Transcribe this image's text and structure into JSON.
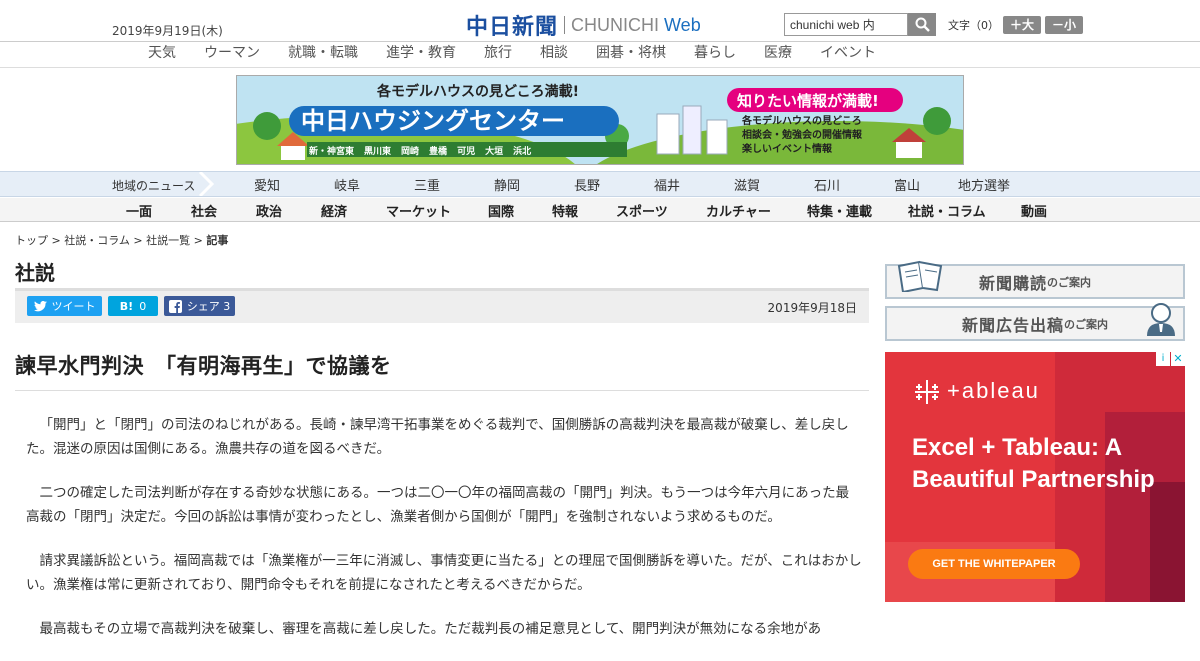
{
  "header": {
    "date": "2019年9月19日(木)",
    "logo_kanji": "中日新聞",
    "logo_en": "CHUNICHI",
    "logo_web": "Web",
    "search_value": "chunichi web 内",
    "font_label": "文字（0）",
    "font_bigger": "＋大",
    "font_smaller": "－小"
  },
  "topnav": [
    "天気",
    "ウーマン",
    "就職・転職",
    "進学・教育",
    "旅行",
    "相談",
    "囲碁・将棋",
    "暮らし",
    "医療",
    "イベント"
  ],
  "banner": {
    "line1": "各モデルハウスの見どころ満載!",
    "line2": "中日ハウジングセンター",
    "right_title": "知りたい情報が満載!",
    "right_items": [
      "各モデルハウスの見どころ",
      "相談会・勉強会の開催情報",
      "楽しいイベント情報"
    ],
    "places": [
      "新・神宮東",
      "黒川東",
      "岡崎",
      "豊橋",
      "可児",
      "大垣",
      "浜北"
    ]
  },
  "region_nav": {
    "label": "地域のニュース",
    "items": [
      "愛知",
      "岐阜",
      "三重",
      "静岡",
      "長野",
      "福井",
      "滋賀",
      "石川",
      "富山",
      "地方選挙"
    ]
  },
  "category_nav": [
    "一面",
    "社会",
    "政治",
    "経済",
    "マーケット",
    "国際",
    "特報",
    "スポーツ",
    "カルチャー",
    "特集・連載",
    "社説・コラム",
    "動画"
  ],
  "breadcrumb": {
    "items": [
      "トップ",
      "社説・コラム",
      "社説一覧"
    ],
    "current": "記事",
    "sep": " > "
  },
  "section_title": "社説",
  "share": {
    "tweet": "ツイート",
    "hatena": "B!",
    "hatena_count": "0",
    "facebook": "シェア",
    "facebook_count": "3"
  },
  "publish_date": "2019年9月18日",
  "headline": "諫早水門判決　「有明海再生」で協議を",
  "paragraphs": [
    "「開門」と「閉門」の司法のねじれがある。長崎・諫早湾干拓事業をめぐる裁判で、国側勝訴の高裁判決を最高裁が破棄し、差し戻した。混迷の原因は国側にある。漁農共存の道を図るべきだ。",
    "二つの確定した司法判断が存在する奇妙な状態にある。一つは二〇一〇年の福岡高裁の「開門」判決。もう一つは今年六月にあった最高裁の「閉門」決定だ。今回の訴訟は事情が変わったとし、漁業者側から国側が「開門」を強制されないよう求めるものだ。",
    "請求異議訴訟という。福岡高裁では「漁業権が一三年に消滅し、事情変更に当たる」との理屈で国側勝訴を導いた。だが、これはおかしい。漁業権は常に更新されており、開門命令もそれを前提になされたと考えるべきだからだ。",
    "最高裁もその立場で高裁判決を破棄し、審理を高裁に差し戻した。ただ裁判長の補足意見として、開門判決が無効になる余地があ"
  ],
  "sidebar": {
    "subscribe_main": "新聞購読",
    "subscribe_sub": "のご案内",
    "ad_main": "新聞広告出稿",
    "ad_sub": "のご案内"
  },
  "ad": {
    "brand": "+ableau",
    "headline": "Excel + Tableau: A Beautiful Partnership",
    "cta": "GET THE WHITEPAPER",
    "info": "i",
    "close": "✕"
  },
  "colors": {
    "brand_blue": "#1b4fa0",
    "twitter": "#1da1f2",
    "hatena": "#00a4de",
    "facebook": "#3b5998",
    "ad_red": "#e3353d",
    "ad_cta": "#fa7a12"
  }
}
